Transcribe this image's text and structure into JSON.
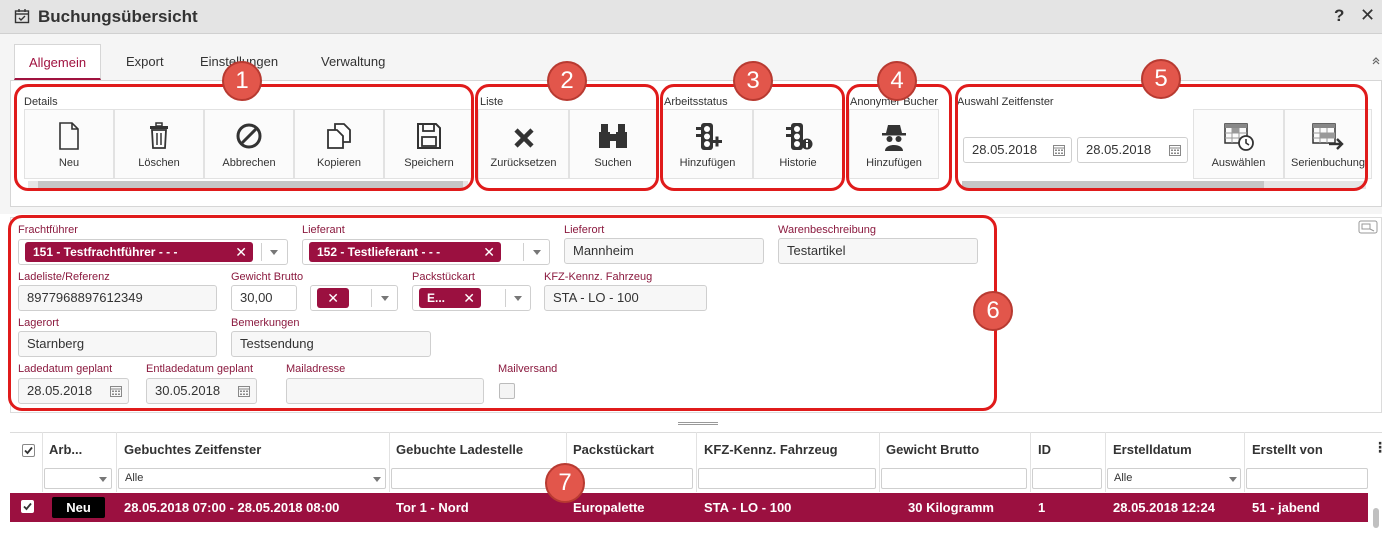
{
  "window": {
    "title": "Buchungsübersicht",
    "help": "?",
    "close": "✕"
  },
  "tabs": [
    "Allgemein",
    "Export",
    "Einstellungen",
    "Verwaltung"
  ],
  "ribbon": {
    "details": {
      "label": "Details",
      "buttons": [
        "Neu",
        "Löschen",
        "Abbrechen",
        "Kopieren",
        "Speichern"
      ]
    },
    "liste": {
      "label": "Liste",
      "buttons": [
        "Zurücksetzen",
        "Suchen"
      ]
    },
    "arbeitsstatus": {
      "label": "Arbeitsstatus",
      "buttons": [
        "Hinzufügen",
        "Historie"
      ]
    },
    "anonymer": {
      "label": "Anonymer Bucher",
      "buttons": [
        "Hinzufügen"
      ]
    },
    "zeitfenster": {
      "label": "Auswahl Zeitfenster",
      "date_from": "28.05.2018",
      "date_to": "28.05.2018",
      "buttons": [
        "Auswählen",
        "Serienbuchung"
      ]
    }
  },
  "markers": [
    "1",
    "2",
    "3",
    "4",
    "5",
    "6",
    "7"
  ],
  "form": {
    "frachtfuehrer": {
      "label": "Frachtführer",
      "tag": "151 - Testfrachtführer - - -"
    },
    "lieferant": {
      "label": "Lieferant",
      "tag": "152 - Testlieferant - - -"
    },
    "lieferort": {
      "label": "Lieferort",
      "value": "Mannheim"
    },
    "warenbeschreibung": {
      "label": "Warenbeschreibung",
      "value": "Testartikel"
    },
    "ladeliste": {
      "label": "Ladeliste/Referenz",
      "value": "8977968897612349"
    },
    "gewicht": {
      "label": "Gewicht Brutto",
      "value": "30,00"
    },
    "packstueckart": {
      "label": "Packstückart",
      "tag": "E..."
    },
    "kfz": {
      "label": "KFZ-Kennz. Fahrzeug",
      "value": "STA - LO - 100"
    },
    "lagerort": {
      "label": "Lagerort",
      "value": "Starnberg"
    },
    "bemerkungen": {
      "label": "Bemerkungen",
      "value": "Testsendung"
    },
    "ladedatum": {
      "label": "Ladedatum geplant",
      "value": "28.05.2018"
    },
    "entladedatum": {
      "label": "Entladedatum geplant",
      "value": "30.05.2018"
    },
    "mailadresse": {
      "label": "Mailadresse",
      "value": ""
    },
    "mailversand": {
      "label": "Mailversand"
    }
  },
  "grid": {
    "columns": [
      "Arb...",
      "Gebuchtes Zeitfenster",
      "Gebuchte Ladestelle",
      "Packstückart",
      "KFZ-Kennz. Fahrzeug",
      "Gewicht Brutto",
      "ID",
      "Erstelldatum",
      "Erstellt von"
    ],
    "filter_all": "Alle",
    "rows": [
      {
        "status": "Neu",
        "zeitfenster": "28.05.2018 07:00 - 28.05.2018 08:00",
        "ladestelle": "Tor 1 - Nord",
        "packstueck": "Europalette",
        "kfz": "STA - LO - 100",
        "gewicht": "30 Kilogramm",
        "id": "1",
        "erstelldatum": "28.05.2018 12:24",
        "erstellt_von": "51 - jabend"
      }
    ]
  },
  "colors": {
    "accent": "#9b1040",
    "highlight": "#e01b1b",
    "marker": "#e2564b"
  }
}
